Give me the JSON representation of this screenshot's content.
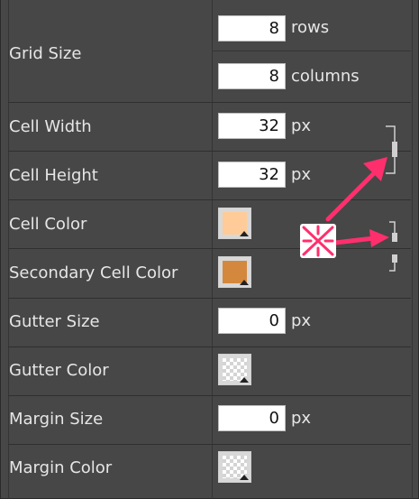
{
  "rows": {
    "grid_size": {
      "label": "Grid Size",
      "rows_value": "8",
      "rows_unit": "rows",
      "cols_value": "8",
      "cols_unit": "columns"
    },
    "cell_width": {
      "label": "Cell Width",
      "value": "32",
      "unit": "px"
    },
    "cell_height": {
      "label": "Cell Height",
      "value": "32",
      "unit": "px"
    },
    "cell_color": {
      "label": "Cell Color",
      "color": "#ffcc99"
    },
    "secondary_cell_color": {
      "label": "Secondary Cell Color",
      "color": "#d4883d"
    },
    "gutter_size": {
      "label": "Gutter Size",
      "value": "0",
      "unit": "px"
    },
    "gutter_color": {
      "label": "Gutter Color",
      "color": "transparent"
    },
    "margin_size": {
      "label": "Margin Size",
      "value": "0",
      "unit": "px"
    },
    "margin_color": {
      "label": "Margin Color",
      "color": "transparent"
    }
  },
  "colors": {
    "annotation": "#ff2f6d"
  },
  "icons": [
    "chain-linked-icon",
    "chain-unlinked-icon",
    "unlink-icon"
  ]
}
